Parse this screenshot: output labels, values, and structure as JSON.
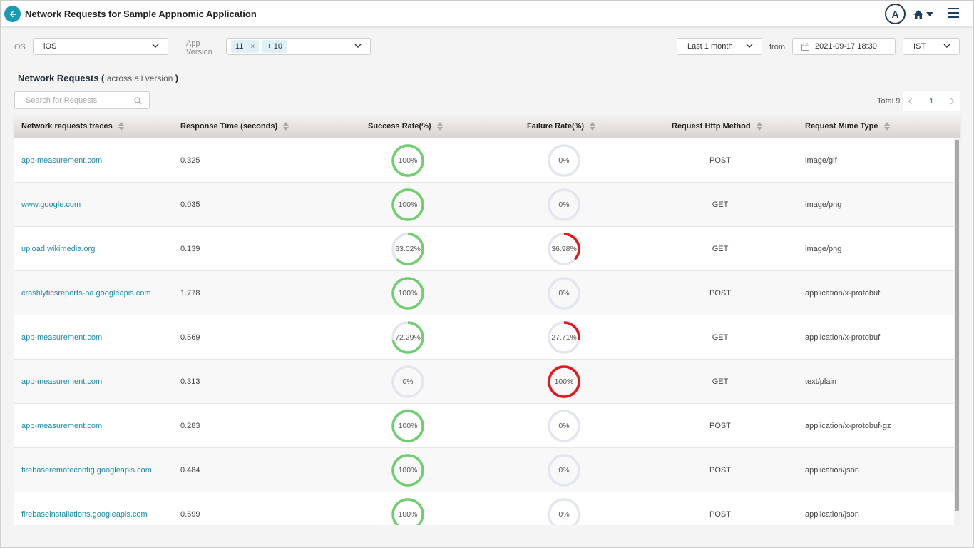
{
  "header": {
    "title": "Network Requests for Sample Appnomic Application",
    "avatar_initial": "A"
  },
  "filters": {
    "os_label": "OS",
    "os_value": "iOS",
    "app_version_label_line1": "App",
    "app_version_label_line2": "Version",
    "version_tag": "11",
    "version_more": "+ 10",
    "range_value": "Last 1 month",
    "from_label": "from",
    "from_date": "2021-09-17 18:30",
    "timezone": "IST"
  },
  "section": {
    "title": "Network Requests",
    "subtitle_open": "(",
    "subtitle": " across all version ",
    "subtitle_close": ")"
  },
  "search": {
    "placeholder": "Search for Requests"
  },
  "pager": {
    "total_label": "Total 9",
    "current_page": "1"
  },
  "table": {
    "columns": [
      "Network requests traces",
      "Response Time (seconds)",
      "Success Rate(%)",
      "Failure Rate(%)",
      "Request Http Method",
      "Request Mime Type"
    ],
    "rows": [
      {
        "trace": "app-measurement.com",
        "response_time": "0.325",
        "success": "100%",
        "success_pct": 100,
        "failure": "0%",
        "failure_pct": 0,
        "method": "POST",
        "mime": "image/gif"
      },
      {
        "trace": "www.google.com",
        "response_time": "0.035",
        "success": "100%",
        "success_pct": 100,
        "failure": "0%",
        "failure_pct": 0,
        "method": "GET",
        "mime": "image/png"
      },
      {
        "trace": "upload.wikimedia.org",
        "response_time": "0.139",
        "success": "63.02%",
        "success_pct": 63.02,
        "failure": "36.98%",
        "failure_pct": 36.98,
        "method": "GET",
        "mime": "image/png"
      },
      {
        "trace": "crashlyticsreports-pa.googleapis.com",
        "response_time": "1.778",
        "success": "100%",
        "success_pct": 100,
        "failure": "0%",
        "failure_pct": 0,
        "method": "POST",
        "mime": "application/x-protobuf"
      },
      {
        "trace": "app-measurement.com",
        "response_time": "0.569",
        "success": "72.29%",
        "success_pct": 72.29,
        "failure": "27.71%",
        "failure_pct": 27.71,
        "method": "GET",
        "mime": "application/x-protobuf"
      },
      {
        "trace": "app-measurement.com",
        "response_time": "0.313",
        "success": "0%",
        "success_pct": 0,
        "failure": "100%",
        "failure_pct": 100,
        "method": "GET",
        "mime": "text/plain"
      },
      {
        "trace": "app-measurement.com",
        "response_time": "0.283",
        "success": "100%",
        "success_pct": 100,
        "failure": "0%",
        "failure_pct": 0,
        "method": "POST",
        "mime": "application/x-protobuf-gz"
      },
      {
        "trace": "firebaseremoteconfig.googleapis.com",
        "response_time": "0.484",
        "success": "100%",
        "success_pct": 100,
        "failure": "0%",
        "failure_pct": 0,
        "method": "POST",
        "mime": "application/json"
      },
      {
        "trace": "firebaseinstallations.googleapis.com",
        "response_time": "0.699",
        "success": "100%",
        "success_pct": 100,
        "failure": "0%",
        "failure_pct": 0,
        "method": "POST",
        "mime": "application/json"
      }
    ]
  },
  "colors": {
    "accent": "#1a9bb3",
    "success": "#6fcf6f",
    "failure": "#e8161a",
    "ring_track": "#e3e6ee"
  },
  "icons": {
    "back": "back-arrow-icon",
    "home": "home-icon",
    "menu": "hamburger-menu-icon",
    "search": "search-icon",
    "calendar": "calendar-icon"
  }
}
